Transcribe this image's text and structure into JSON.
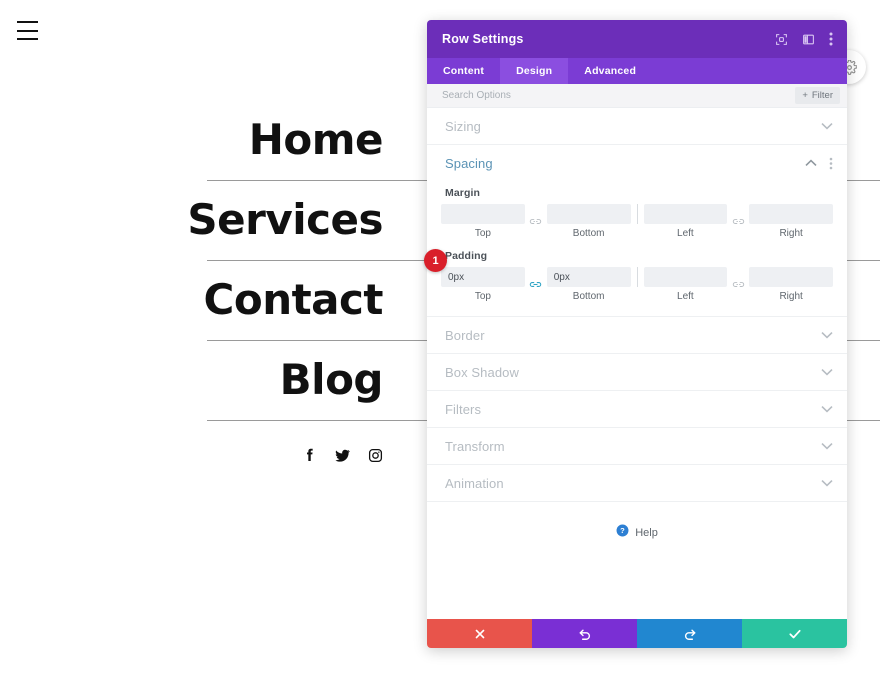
{
  "page": {
    "hamburger_icon": "hamburger-menu-icon",
    "menu_items": [
      {
        "label": "Home"
      },
      {
        "label": "Services"
      },
      {
        "label": "Contact"
      },
      {
        "label": "Blog"
      }
    ],
    "social_icons": [
      {
        "name": "facebook-icon",
        "label": "Facebook"
      },
      {
        "name": "twitter-icon",
        "label": "Twitter"
      },
      {
        "name": "instagram-icon",
        "label": "Instagram"
      }
    ],
    "round_toggle_icon": "settings-gear-icon"
  },
  "modal": {
    "title": "Row Settings",
    "header_icons": [
      {
        "name": "expand-fullscreen-icon"
      },
      {
        "name": "panel-layout-icon"
      },
      {
        "name": "more-vertical-icon"
      }
    ],
    "tabs": [
      {
        "label": "Content",
        "active": false
      },
      {
        "label": "Design",
        "active": true
      },
      {
        "label": "Advanced",
        "active": false
      }
    ],
    "search": {
      "placeholder": "Search Options",
      "value": ""
    },
    "filter": {
      "label": "Filter",
      "icon": "plus-icon"
    },
    "sections": [
      {
        "id": "sizing",
        "title": "Sizing",
        "open": false
      },
      {
        "id": "spacing",
        "title": "Spacing",
        "open": true
      },
      {
        "id": "border",
        "title": "Border",
        "open": false
      },
      {
        "id": "box_shadow",
        "title": "Box Shadow",
        "open": false
      },
      {
        "id": "filters",
        "title": "Filters",
        "open": false
      },
      {
        "id": "transform",
        "title": "Transform",
        "open": false
      },
      {
        "id": "animation",
        "title": "Animation",
        "open": false
      }
    ],
    "spacing": {
      "margin": {
        "label": "Margin",
        "top": {
          "value": "",
          "sublabel": "Top"
        },
        "bottom": {
          "value": "",
          "sublabel": "Bottom"
        },
        "left": {
          "value": "",
          "sublabel": "Left"
        },
        "right": {
          "value": "",
          "sublabel": "Right"
        },
        "link_tb_active": false,
        "link_lr_active": false
      },
      "padding": {
        "label": "Padding",
        "top": {
          "value": "0px",
          "sublabel": "Top"
        },
        "bottom": {
          "value": "0px",
          "sublabel": "Bottom"
        },
        "left": {
          "value": "",
          "sublabel": "Left"
        },
        "right": {
          "value": "",
          "sublabel": "Right"
        },
        "link_tb_active": true,
        "link_lr_active": false
      }
    },
    "help": {
      "label": "Help",
      "icon": "help-question-icon"
    },
    "footer_buttons": [
      {
        "name": "cancel-button",
        "icon": "close-x-icon",
        "color": "#e8544b"
      },
      {
        "name": "undo-button",
        "icon": "undo-icon",
        "color": "#7a2fd4"
      },
      {
        "name": "redo-button",
        "icon": "redo-icon",
        "color": "#2187d0"
      },
      {
        "name": "save-button",
        "icon": "check-icon",
        "color": "#2ac3a0"
      }
    ]
  },
  "annotation": {
    "badge_number": "1",
    "badge_color": "#d91f2a"
  },
  "colors": {
    "header_purple": "#6c2eb9",
    "tabbar_purple": "#7b3cd4",
    "tab_active_purple": "#8b4ee0",
    "section_active_blue": "#5b93b5",
    "link_active_blue": "#2ea3c4"
  }
}
